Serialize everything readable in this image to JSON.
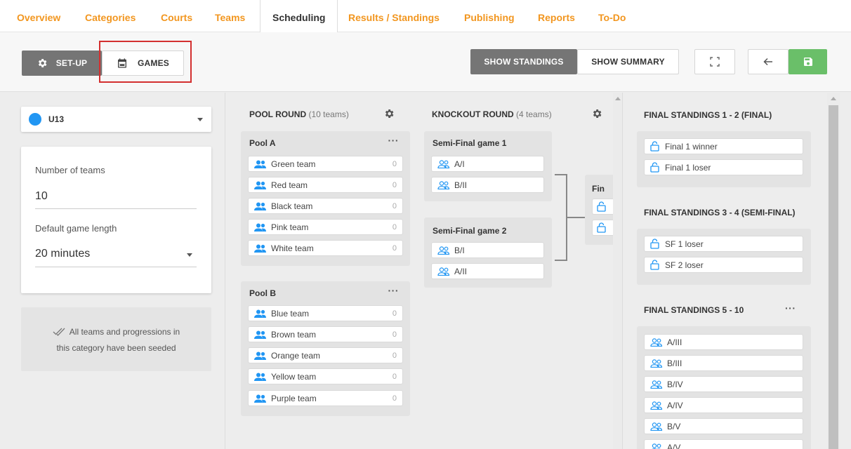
{
  "nav": {
    "tabs": [
      {
        "label": "Overview"
      },
      {
        "label": "Categories"
      },
      {
        "label": "Courts"
      },
      {
        "label": "Teams"
      },
      {
        "label": "Scheduling"
      },
      {
        "label": "Results / Standings"
      },
      {
        "label": "Publishing"
      },
      {
        "label": "Reports"
      },
      {
        "label": "To-Do"
      }
    ]
  },
  "toolbar": {
    "setup_label": "SET-UP",
    "games_label": "GAMES",
    "show_standings": "SHOW STANDINGS",
    "show_summary": "SHOW SUMMARY"
  },
  "left": {
    "category": "U13",
    "category_color": "#2196f3",
    "teams_label": "Number of teams",
    "teams_value": "10",
    "game_length_label": "Default game length",
    "game_length_value": "20 minutes",
    "notice_line1": "All teams and progressions in",
    "notice_line2": "this category have been seeded"
  },
  "pool_round": {
    "title": "POOL ROUND",
    "count": "(10 teams)",
    "pools": [
      {
        "name": "Pool A",
        "teams": [
          {
            "name": "Green team",
            "score": "0"
          },
          {
            "name": "Red team",
            "score": "0"
          },
          {
            "name": "Black team",
            "score": "0"
          },
          {
            "name": "Pink team",
            "score": "0"
          },
          {
            "name": "White team",
            "score": "0"
          }
        ]
      },
      {
        "name": "Pool B",
        "teams": [
          {
            "name": "Blue team",
            "score": "0"
          },
          {
            "name": "Brown team",
            "score": "0"
          },
          {
            "name": "Orange team",
            "score": "0"
          },
          {
            "name": "Yellow team",
            "score": "0"
          },
          {
            "name": "Purple team",
            "score": "0"
          }
        ]
      }
    ]
  },
  "knockout": {
    "title": "KNOCKOUT ROUND",
    "count": "(4 teams)",
    "games": [
      {
        "name": "Semi-Final game 1",
        "slots": [
          "A/I",
          "B/II"
        ]
      },
      {
        "name": "Semi-Final game 2",
        "slots": [
          "B/I",
          "A/II"
        ]
      }
    ],
    "final_partial": "Fin"
  },
  "standings": {
    "groups": [
      {
        "title": "FINAL STANDINGS 1 - 2 (FINAL)",
        "items": [
          "Final 1 winner",
          "Final 1 loser"
        ]
      },
      {
        "title": "FINAL STANDINGS 3 - 4 (SEMI-FINAL)",
        "items": [
          "SF 1 loser",
          "SF 2 loser"
        ]
      },
      {
        "title": "FINAL STANDINGS 5 - 10",
        "items": [
          "A/III",
          "B/III",
          "B/IV",
          "A/IV",
          "B/V",
          "A/V"
        ]
      }
    ]
  },
  "colors": {
    "accent_orange": "#f2961f",
    "icon_blue": "#2196f3",
    "save_green": "#6abf69",
    "highlight_red": "#d32f2f"
  }
}
